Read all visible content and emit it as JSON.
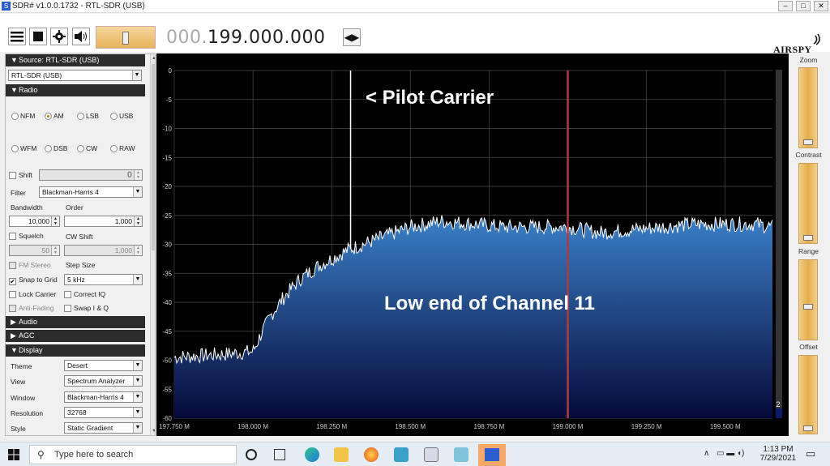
{
  "window": {
    "title": "SDR# v1.0.0.1732 - RTL-SDR (USB)",
    "min": "–",
    "max": "□",
    "close": "✕"
  },
  "toolbar": {
    "freq_lead": "000.",
    "freq_main": "199.000.000",
    "logo": "AIRSPY",
    "volume_fraction": 0.55
  },
  "source": {
    "header": "Source: RTL-SDR (USB)",
    "device": "RTL-SDR (USB)"
  },
  "radio": {
    "header": "Radio",
    "modes": [
      "NFM",
      "AM",
      "LSB",
      "USB",
      "WFM",
      "DSB",
      "CW",
      "RAW"
    ],
    "selected_mode": "AM",
    "shift_label": "Shift",
    "shift_value": "0",
    "filter_label": "Filter",
    "filter_value": "Blackman-Harris 4",
    "bandwidth_label": "Bandwidth",
    "order_label": "Order",
    "bandwidth_value": "10,000",
    "order_value": "1,000",
    "squelch_label": "Squelch",
    "cwshift_label": "CW Shift",
    "squelch_value": "50",
    "cwshift_value": "1,000",
    "fmstereo_label": "FM Stereo",
    "stepsize_label": "Step Size",
    "snap_label": "Snap to Grid",
    "step_value": "5 kHz",
    "lock_label": "Lock Carrier",
    "correctiq_label": "Correct IQ",
    "antifade_label": "Anti-Fading",
    "swapiq_label": "Swap I & Q"
  },
  "audio": {
    "header": "Audio"
  },
  "agc": {
    "header": "AGC"
  },
  "display": {
    "header": "Display",
    "rows": [
      {
        "label": "Theme",
        "value": "Desert"
      },
      {
        "label": "View",
        "value": "Spectrum Analyzer"
      },
      {
        "label": "Window",
        "value": "Blackman-Harris 4"
      },
      {
        "label": "Resolution",
        "value": "32768"
      },
      {
        "label": "Style",
        "value": "Static Gradient"
      }
    ]
  },
  "spectrum": {
    "annotations": [
      "< Pilot Carrier",
      "Low end of Channel 11"
    ],
    "corner_value": "2",
    "colors": {
      "fill_top": "#3a80c8",
      "fill_bottom": "#050a3a",
      "trace": "#ffffff",
      "center_line": "#b43a3a",
      "grid": "#4a4a4a"
    }
  },
  "chart_data": {
    "type": "area",
    "xlabel": "",
    "ylabel": "",
    "x_ticks": [
      "197.750 M",
      "198.000 M",
      "198.250 M",
      "198.500 M",
      "198.750 M",
      "199.000 M",
      "199.250 M",
      "199.500 M"
    ],
    "y_ticks": [
      "0",
      "-5",
      "-10",
      "-15",
      "-20",
      "-25",
      "-30",
      "-35",
      "-40",
      "-45",
      "-50",
      "-55",
      "-60"
    ],
    "xlim_mhz": [
      197.75,
      199.65
    ],
    "ylim_db": [
      -60,
      0
    ],
    "grid": true,
    "pilot_carrier_mhz": 198.31,
    "center_mhz": 199.0,
    "x_mhz": [
      197.75,
      197.9,
      198.0,
      198.03,
      198.06,
      198.1,
      198.15,
      198.2,
      198.25,
      198.3,
      198.35,
      198.4,
      198.45,
      198.5,
      198.55,
      198.6,
      198.7,
      198.8,
      198.9,
      199.0,
      199.1,
      199.2,
      199.3,
      199.4,
      199.5,
      199.6,
      199.65
    ],
    "y_db": [
      -49.5,
      -49,
      -48.5,
      -45,
      -42,
      -39,
      -36,
      -34,
      -32.5,
      -31,
      -30,
      -29,
      -28,
      -27,
      -26.5,
      -26,
      -26.5,
      -27,
      -27,
      -27,
      -28,
      -27.5,
      -27,
      -26.5,
      -26.5,
      -26.5,
      -27
    ]
  },
  "right_panel": {
    "zoom_label": "Zoom",
    "contrast_label": "Contrast",
    "range_label": "Range",
    "offset_label": "Offset",
    "zoom_fraction": 0.02,
    "contrast_fraction": 0.02,
    "range_fraction": 0.4,
    "offset_fraction": 0.02
  },
  "taskbar": {
    "search_placeholder": "Type here to search",
    "time": "1:13 PM",
    "date": "7/29/2021"
  }
}
